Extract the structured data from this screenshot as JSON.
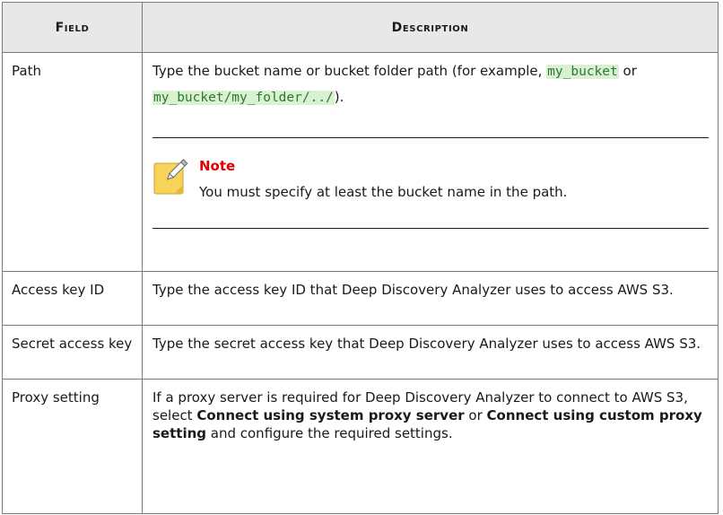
{
  "table": {
    "headers": [
      "Field",
      "Description"
    ],
    "rows": [
      {
        "field": "Path",
        "desc_before": "Type the bucket name or bucket folder path (for example, ",
        "code1": "my_bucket",
        "desc_mid": " or ",
        "code2": "my_bucket/my_folder/../",
        "desc_after": ").",
        "note_title": "Note",
        "note_text": "You must specify at least the bucket name in the path."
      },
      {
        "field": "Access key ID",
        "description": "Type the access key ID that Deep Discovery Analyzer uses to access AWS S3."
      },
      {
        "field": "Secret access key",
        "description": "Type the secret access key that Deep Discovery Analyzer uses to access AWS S3."
      },
      {
        "field": "Proxy setting",
        "desc_1": "If a proxy server is required for Deep Discovery Analyzer to connect to AWS S3, select ",
        "bold_1": "Connect using system proxy server",
        "desc_2": " or ",
        "bold_2": "Connect using custom proxy setting",
        "desc_3": " and configure the required settings."
      }
    ]
  },
  "colors": {
    "header_bg": "#e8e8e8",
    "code_bg": "#d9f0d3",
    "note_title": "#e00000"
  },
  "icons": {
    "note": "note-pencil-icon"
  }
}
